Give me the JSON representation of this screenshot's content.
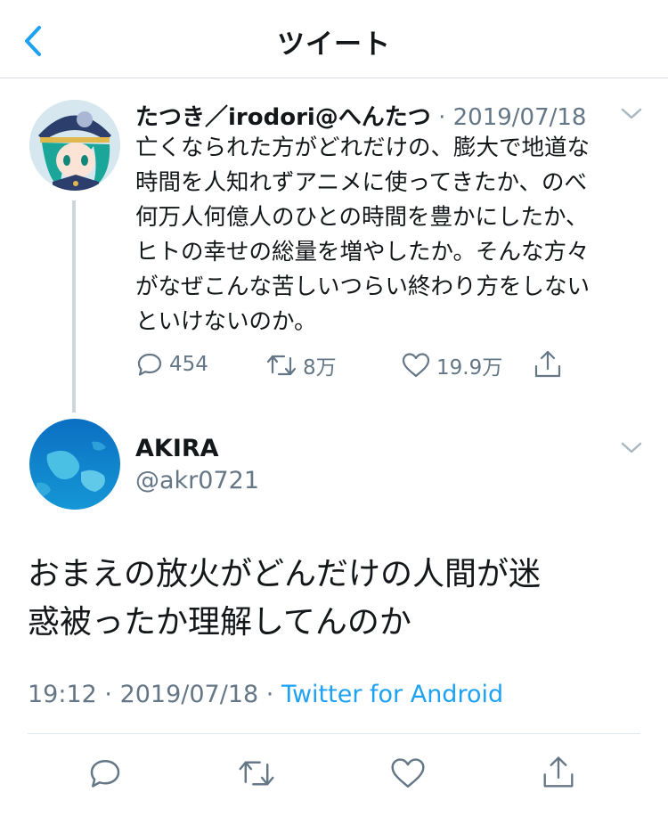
{
  "nav": {
    "title": "ツイート",
    "back_icon": "chevron-left-icon"
  },
  "colors": {
    "accent": "#1da1f2",
    "text": "#14171a",
    "secondary": "#657786",
    "thread_line": "#ccd6dd"
  },
  "parent_tweet": {
    "author": "たつき／irodori@へんたつ",
    "separator": " · ",
    "date": "2019/07/18",
    "text": "亡くなられた方がどれだけの、膨大で地道な\n時間を人知れずアニメに使ってきたか、のべ\n何万人何億人のひとの時間を豊かにしたか、\nヒトの幸せの総量を増やしたか。そんな方々\nがなぜこんな苦しいつらい終わり方をしない\nといけないのか。",
    "replies": "454",
    "retweets": "8万",
    "likes": "19.9万"
  },
  "main_tweet": {
    "author": "AKIRA",
    "handle": "@akr0721",
    "text": "おまえの放火がどんだけの人間が迷\n惑被ったか理解してんのか",
    "time": "19:12",
    "separator": " · ",
    "date": "2019/07/18",
    "source": "Twitter for Android"
  }
}
